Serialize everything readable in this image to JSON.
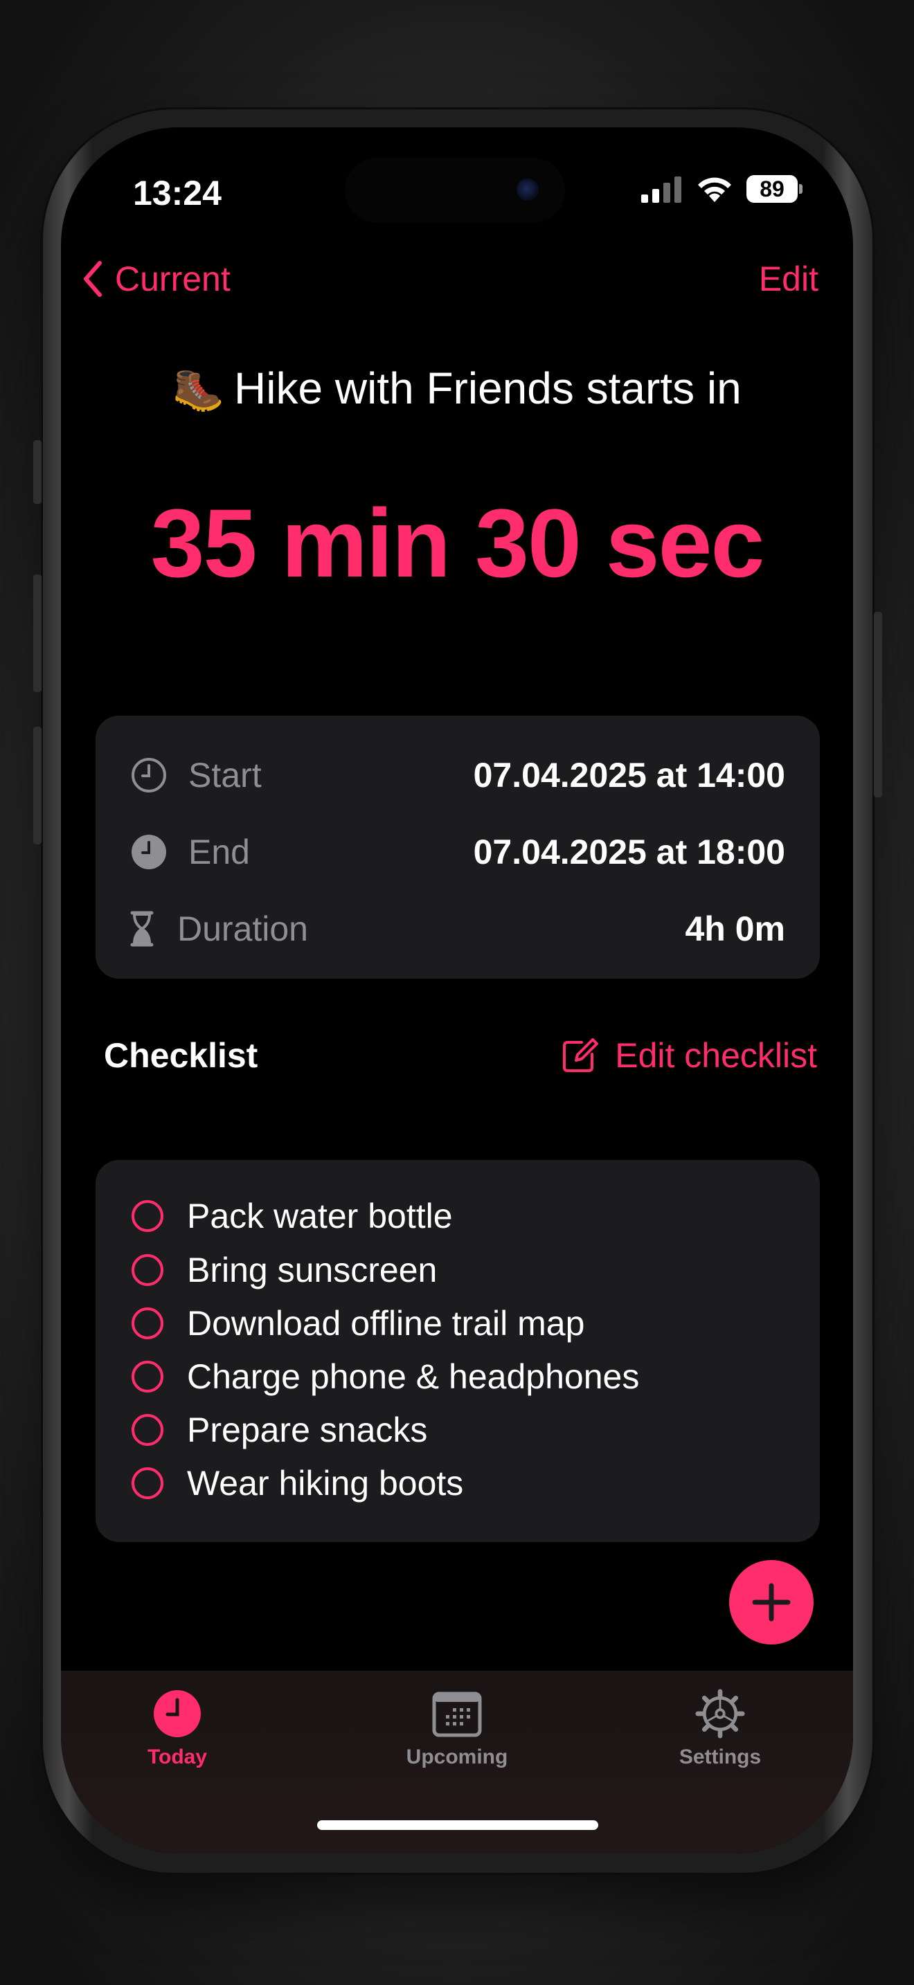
{
  "status_bar": {
    "time": "13:24",
    "battery": "89"
  },
  "nav": {
    "back_label": "Current",
    "edit_label": "Edit"
  },
  "event": {
    "emoji": "🥾",
    "title": "Hike with Friends starts in",
    "countdown": "35 min 30 sec"
  },
  "details": [
    {
      "icon": "clock-icon",
      "label": "Start",
      "value": "07.04.2025 at 14:00"
    },
    {
      "icon": "clock-filled-icon",
      "label": "End",
      "value": "07.04.2025 at 18:00"
    },
    {
      "icon": "hourglass-icon",
      "label": "Duration",
      "value": "4h 0m"
    }
  ],
  "checklist": {
    "title": "Checklist",
    "edit_label": "Edit checklist",
    "items": [
      {
        "label": "Pack water bottle",
        "checked": false
      },
      {
        "label": "Bring sunscreen",
        "checked": false
      },
      {
        "label": "Download offline trail map",
        "checked": false
      },
      {
        "label": "Charge phone & headphones",
        "checked": false
      },
      {
        "label": "Prepare snacks",
        "checked": false
      },
      {
        "label": "Wear hiking boots",
        "checked": false
      }
    ]
  },
  "tabs": [
    {
      "label": "Today",
      "icon": "clock-filled-icon",
      "active": true
    },
    {
      "label": "Upcoming",
      "icon": "calendar-icon",
      "active": false
    },
    {
      "label": "Settings",
      "icon": "gear-icon",
      "active": false
    }
  ],
  "colors": {
    "accent": "#ff2d6b",
    "card_background": "#1c1c1e",
    "secondary_text": "#8e8e93"
  }
}
